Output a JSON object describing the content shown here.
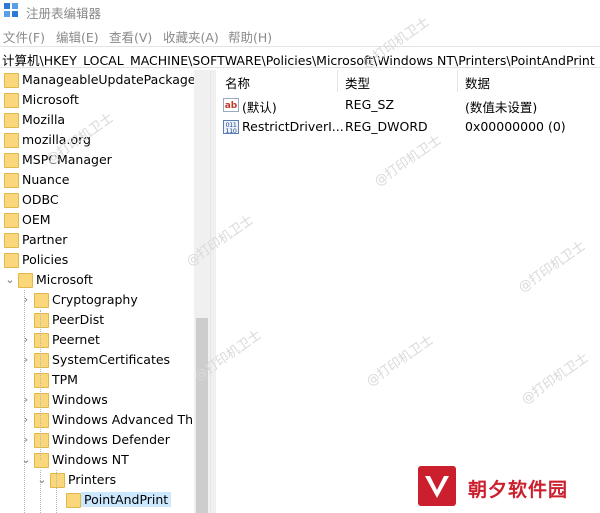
{
  "window": {
    "title": "注册表编辑器"
  },
  "menu": [
    "文件(F)",
    "编辑(E)",
    "查看(V)",
    "收藏夹(A)",
    "帮助(H)"
  ],
  "address": "计算机\\HKEY_LOCAL_MACHINE\\SOFTWARE\\Policies\\Microsoft\\Windows NT\\Printers\\PointAndPrint",
  "tree": [
    {
      "label": "ManageableUpdatePackage",
      "depth": 0,
      "expander": ""
    },
    {
      "label": "Microsoft",
      "depth": 0,
      "expander": ""
    },
    {
      "label": "Mozilla",
      "depth": 0,
      "expander": ""
    },
    {
      "label": "mozilla.org",
      "depth": 0,
      "expander": ""
    },
    {
      "label": "MSPCManager",
      "depth": 0,
      "expander": ""
    },
    {
      "label": "Nuance",
      "depth": 0,
      "expander": ""
    },
    {
      "label": "ODBC",
      "depth": 0,
      "expander": ""
    },
    {
      "label": "OEM",
      "depth": 0,
      "expander": ""
    },
    {
      "label": "Partner",
      "depth": 0,
      "expander": ""
    },
    {
      "label": "Policies",
      "depth": 0,
      "expander": ""
    },
    {
      "label": "Microsoft",
      "depth": 1,
      "expander": "expanded"
    },
    {
      "label": "Cryptography",
      "depth": 2,
      "expander": "collapsed"
    },
    {
      "label": "PeerDist",
      "depth": 2,
      "expander": ""
    },
    {
      "label": "Peernet",
      "depth": 2,
      "expander": "collapsed"
    },
    {
      "label": "SystemCertificates",
      "depth": 2,
      "expander": "collapsed"
    },
    {
      "label": "TPM",
      "depth": 2,
      "expander": ""
    },
    {
      "label": "Windows",
      "depth": 2,
      "expander": "collapsed"
    },
    {
      "label": "Windows Advanced Threat Protection",
      "depth": 2,
      "expander": "collapsed"
    },
    {
      "label": "Windows Defender",
      "depth": 2,
      "expander": "collapsed"
    },
    {
      "label": "Windows NT",
      "depth": 2,
      "expander": "expanded"
    },
    {
      "label": "Printers",
      "depth": 3,
      "expander": "expanded"
    },
    {
      "label": "PointAndPrint",
      "depth": 4,
      "expander": "",
      "selected": true
    }
  ],
  "list": {
    "headers": {
      "name": "名称",
      "type": "类型",
      "data": "数据"
    },
    "rows": [
      {
        "icon": "string-value-icon",
        "icon_text": "ab",
        "name": "(默认)",
        "type": "REG_SZ",
        "data": "(数值未设置)"
      },
      {
        "icon": "binary-value-icon",
        "icon_text": "011\n110",
        "name": "RestrictDriverI...",
        "type": "REG_DWORD",
        "data": "0x00000000 (0)"
      }
    ]
  },
  "watermark": "@打印机卫士",
  "brand": {
    "name": "朝夕软件园",
    "color": "#cc1f2e"
  },
  "colors": {
    "folder": "#f9d77a",
    "selection": "#cce8ff",
    "app_icon": "#2b7bd6"
  }
}
